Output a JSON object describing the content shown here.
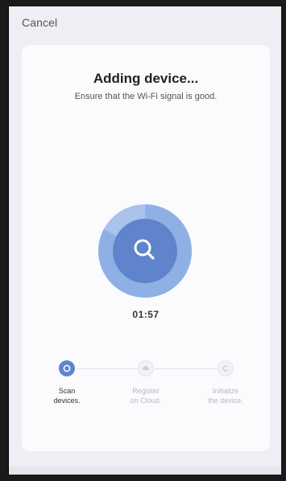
{
  "header": {
    "cancel_label": "Cancel"
  },
  "card": {
    "title": "Adding device...",
    "subtitle": "Ensure that the Wi-Fi signal is good.",
    "timer": "01:57"
  },
  "steps": [
    {
      "label": "Scan\ndevices.",
      "state": "active",
      "icon": "scan-icon"
    },
    {
      "label": "Register\non Cloud.",
      "state": "inactive",
      "icon": "cloud-icon"
    },
    {
      "label": "Initialize\nthe device.",
      "state": "inactive",
      "icon": "initialize-icon"
    }
  ],
  "colors": {
    "accent": "#5f84cc",
    "ring_outer": "#a9c3ec",
    "ring_progress": "#8fb0e4",
    "card_bg": "#fbfbfd",
    "screen_bg": "#eeeff4"
  },
  "icons": {
    "scanner": "search-icon"
  }
}
